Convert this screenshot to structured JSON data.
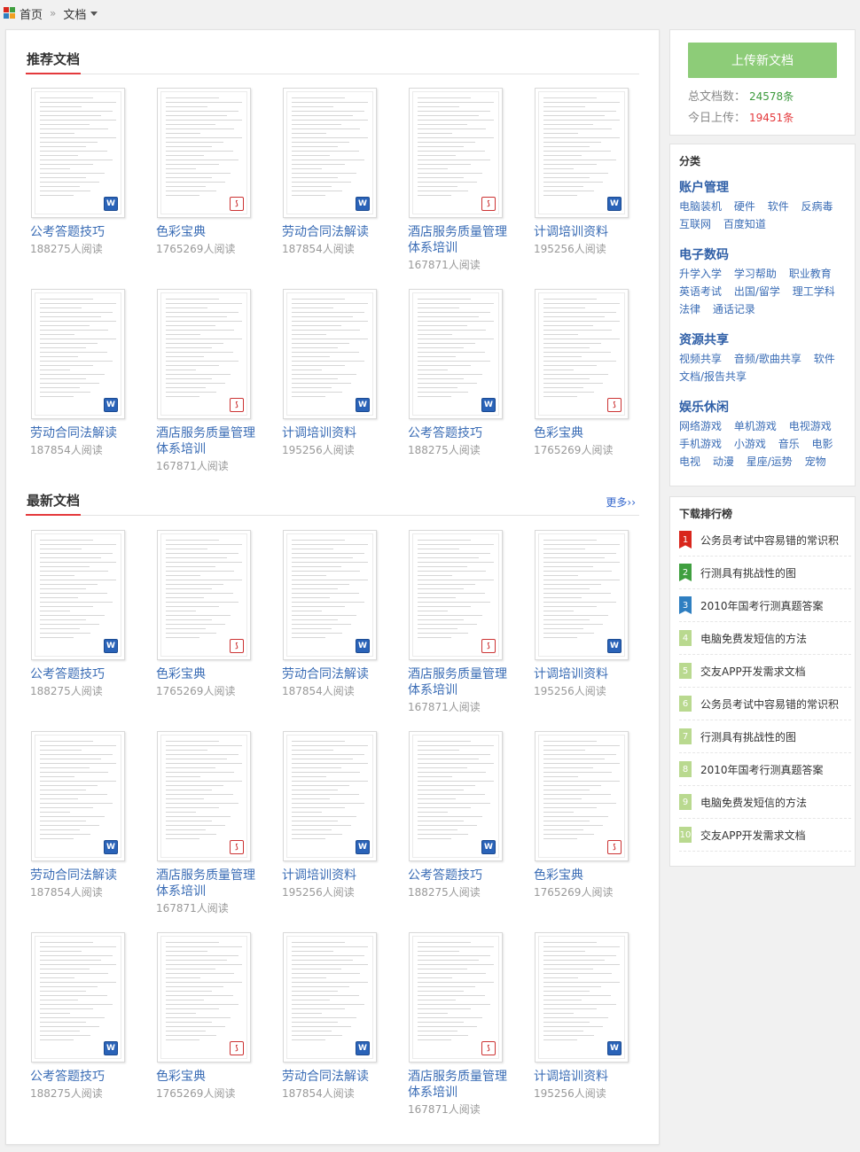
{
  "breadcrumb": {
    "home": "首页",
    "sep": "»",
    "current": "文档"
  },
  "main": {
    "recommended_title": "推荐文档",
    "latest_title": "最新文档",
    "more_label": "更多››"
  },
  "recommended": [
    {
      "title": "公考答题技巧",
      "reads": "188275人阅读",
      "type": "word"
    },
    {
      "title": "色彩宝典",
      "reads": "1765269人阅读",
      "type": "pdf"
    },
    {
      "title": "劳动合同法解读",
      "reads": "187854人阅读",
      "type": "word"
    },
    {
      "title": "酒店服务质量管理体系培训",
      "reads": "167871人阅读",
      "type": "pdf"
    },
    {
      "title": "计调培训资料",
      "reads": "195256人阅读",
      "type": "word"
    },
    {
      "title": "劳动合同法解读",
      "reads": "187854人阅读",
      "type": "word"
    },
    {
      "title": "酒店服务质量管理体系培训",
      "reads": "167871人阅读",
      "type": "pdf"
    },
    {
      "title": "计调培训资料",
      "reads": "195256人阅读",
      "type": "word"
    },
    {
      "title": "公考答题技巧",
      "reads": "188275人阅读",
      "type": "word"
    },
    {
      "title": "色彩宝典",
      "reads": "1765269人阅读",
      "type": "pdf"
    }
  ],
  "latest": [
    {
      "title": "公考答题技巧",
      "reads": "188275人阅读",
      "type": "word"
    },
    {
      "title": "色彩宝典",
      "reads": "1765269人阅读",
      "type": "pdf"
    },
    {
      "title": "劳动合同法解读",
      "reads": "187854人阅读",
      "type": "word"
    },
    {
      "title": "酒店服务质量管理体系培训",
      "reads": "167871人阅读",
      "type": "pdf"
    },
    {
      "title": "计调培训资料",
      "reads": "195256人阅读",
      "type": "word"
    },
    {
      "title": "劳动合同法解读",
      "reads": "187854人阅读",
      "type": "word"
    },
    {
      "title": "酒店服务质量管理体系培训",
      "reads": "167871人阅读",
      "type": "pdf"
    },
    {
      "title": "计调培训资料",
      "reads": "195256人阅读",
      "type": "word"
    },
    {
      "title": "公考答题技巧",
      "reads": "188275人阅读",
      "type": "word"
    },
    {
      "title": "色彩宝典",
      "reads": "1765269人阅读",
      "type": "pdf"
    },
    {
      "title": "公考答题技巧",
      "reads": "188275人阅读",
      "type": "word"
    },
    {
      "title": "色彩宝典",
      "reads": "1765269人阅读",
      "type": "pdf"
    },
    {
      "title": "劳动合同法解读",
      "reads": "187854人阅读",
      "type": "word"
    },
    {
      "title": "酒店服务质量管理体系培训",
      "reads": "167871人阅读",
      "type": "pdf"
    },
    {
      "title": "计调培训资料",
      "reads": "195256人阅读",
      "type": "word"
    }
  ],
  "sidebar": {
    "upload_label": "上传新文档",
    "total_label": "总文档数：",
    "total_value": "24578条",
    "today_label": "今日上传：",
    "today_value": "19451条",
    "categories_title": "分类",
    "categories": [
      {
        "name": "账户管理",
        "items": [
          "电脑装机",
          "硬件",
          "软件",
          "反病毒",
          "互联网",
          "百度知道"
        ]
      },
      {
        "name": "电子数码",
        "items": [
          "升学入学",
          "学习帮助",
          "职业教育",
          "英语考试",
          "出国/留学",
          "理工学科",
          "法律",
          "通话记录"
        ]
      },
      {
        "name": "资源共享",
        "items": [
          "视频共享",
          "音频/歌曲共享",
          "软件",
          "文档/报告共享"
        ]
      },
      {
        "name": "娱乐休闲",
        "items": [
          "网络游戏",
          "单机游戏",
          "电视游戏",
          "手机游戏",
          "小游戏",
          "音乐",
          "电影",
          "电视",
          "动漫",
          "星座/运势",
          "宠物"
        ]
      }
    ],
    "ranking_title": "下载排行榜",
    "ranking": [
      {
        "num": "1",
        "title": "公务员考试中容易错的常识积"
      },
      {
        "num": "2",
        "title": "行测具有挑战性的图"
      },
      {
        "num": "3",
        "title": "2010年国考行测真题答案"
      },
      {
        "num": "4",
        "title": "电脑免费发短信的方法"
      },
      {
        "num": "5",
        "title": "交友APP开发需求文档"
      },
      {
        "num": "6",
        "title": "公务员考试中容易错的常识积"
      },
      {
        "num": "7",
        "title": "行测具有挑战性的图"
      },
      {
        "num": "8",
        "title": "2010年国考行测真题答案"
      },
      {
        "num": "9",
        "title": "电脑免费发短信的方法"
      },
      {
        "num": "10",
        "title": "交友APP开发需求文档"
      }
    ]
  },
  "colors": {
    "accent_red": "#e4393c",
    "link_blue": "#3a6cb5",
    "upload_green": "#8dcc78",
    "total_green": "#3c9a3c",
    "today_red": "#e4393c",
    "rank1": "#d9261c",
    "rank2": "#3f9f3f",
    "rank3": "#2f7fc1"
  },
  "icons": {
    "word": "word-file-icon",
    "pdf": "pdf-file-icon",
    "home": "home-grid-icon"
  }
}
